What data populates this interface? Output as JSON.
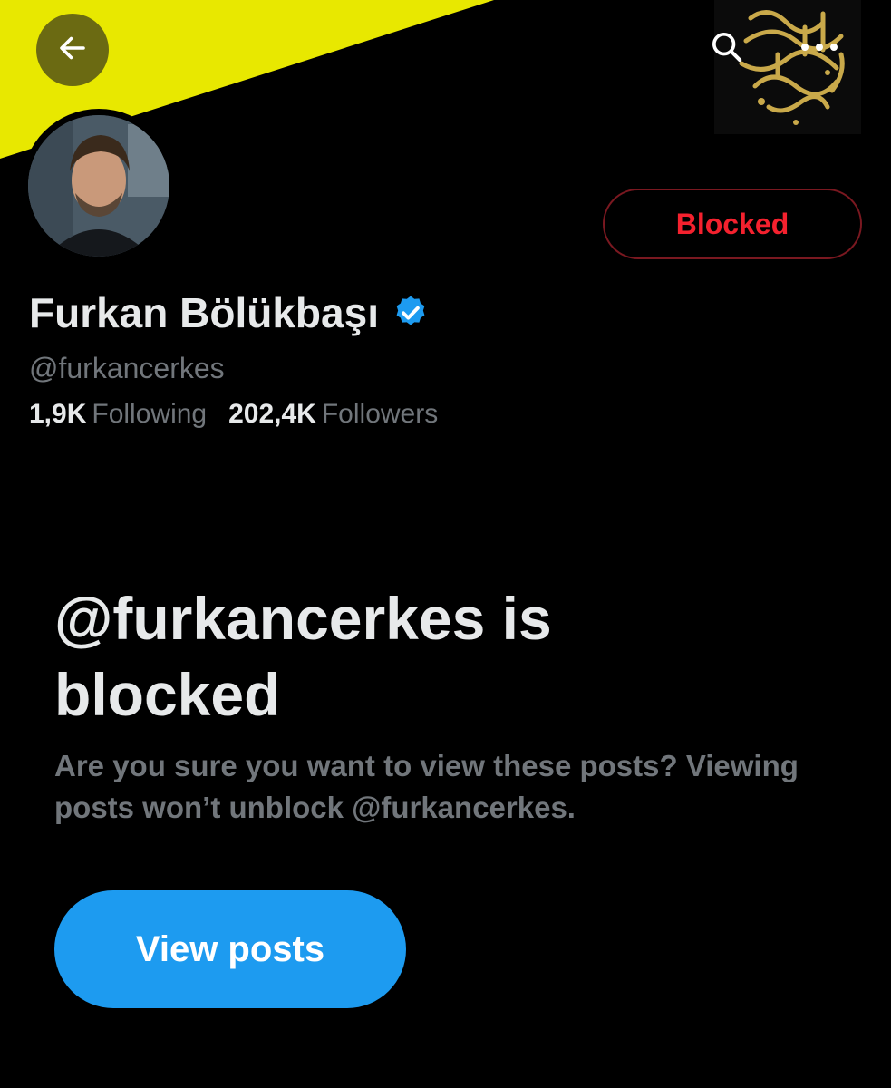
{
  "header": {
    "back_icon": "arrow-left-icon",
    "search_icon": "search-icon",
    "more_icon": "more-horizontal-icon",
    "banner_colors": {
      "yellow": "#e6e600",
      "black": "#000000"
    }
  },
  "profile": {
    "display_name": "Furkan Bölükbaşı",
    "verified_icon": "verified-badge-icon",
    "handle": "@furkancerkes",
    "following_count": "1,9K",
    "following_label": "Following",
    "followers_count": "202,4K",
    "followers_label": "Followers",
    "blocked_button_label": "Blocked"
  },
  "blocked_notice": {
    "title": "@furkancerkes is blocked",
    "description": "Are you sure you want to view these posts? Viewing posts won’t unblock @furkancerkes.",
    "view_posts_label": "View posts"
  },
  "colors": {
    "accent_blue": "#1d9bf0",
    "blocked_red": "#f4212e",
    "text_primary": "#e7e9ea",
    "text_secondary": "#71767b"
  }
}
